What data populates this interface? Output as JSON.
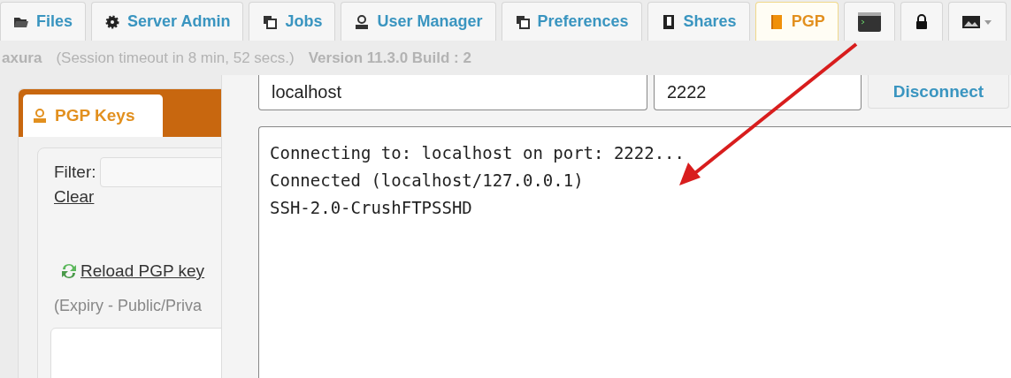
{
  "tabs": [
    {
      "kind": "text",
      "label": "Files",
      "selected": false
    },
    {
      "kind": "text",
      "label": "Server Admin",
      "selected": false
    },
    {
      "kind": "text",
      "label": "Jobs",
      "selected": false
    },
    {
      "kind": "text",
      "label": "User Manager",
      "selected": false
    },
    {
      "kind": "text",
      "label": "Preferences",
      "selected": false
    },
    {
      "kind": "text",
      "label": "Shares",
      "selected": false
    },
    {
      "kind": "text",
      "label": "PGP",
      "selected": true
    },
    {
      "kind": "icon",
      "selected": false
    },
    {
      "kind": "icon",
      "selected": false
    },
    {
      "kind": "menu",
      "selected": false
    }
  ],
  "status_bar": {
    "user": "axura",
    "session": "(Session timeout in 8 min, 52 secs.)",
    "version": "Version 11.3.0 Build : 2"
  },
  "pgp_panel": {
    "tab": "PGP Keys",
    "filter_label": "Filter:",
    "clear_link": "Clear",
    "reload_link": "Reload PGP key",
    "note": "(Expiry - Public/Priva"
  },
  "connection": {
    "host": "localhost",
    "port": "2222",
    "button": "Disconnect"
  },
  "terminal": {
    "lines": [
      "Connecting to: localhost on port: 2222...",
      "Connected (localhost/127.0.0.1)",
      "SSH-2.0-CrushFTPSSHD"
    ]
  }
}
